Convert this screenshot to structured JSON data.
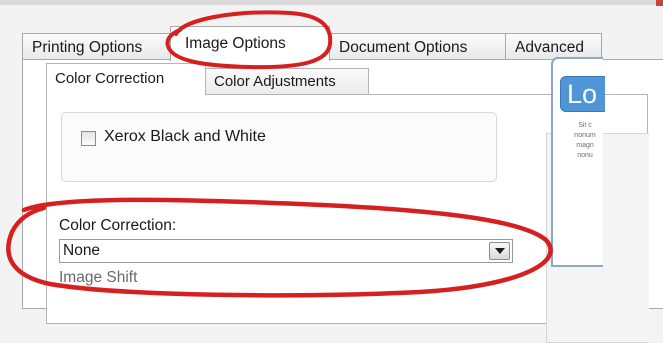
{
  "main_tabs": [
    {
      "label": "Printing Options"
    },
    {
      "label": "Image Options",
      "active": true
    },
    {
      "label": "Document Options"
    },
    {
      "label": "Advanced"
    }
  ],
  "sub_tabs": [
    {
      "label": "Color Correction",
      "active": true
    },
    {
      "label": "Color Adjustments"
    }
  ],
  "bw_option": {
    "label": "Xerox Black and White",
    "checked": false
  },
  "color_correction": {
    "label": "Color Correction:",
    "value": "None"
  },
  "next_section": {
    "label": "Image Shift"
  },
  "preview": {
    "logo_text": "Lo",
    "lines": [
      "Sit c",
      "nonum",
      "magn",
      "nonu"
    ]
  },
  "colors": {
    "annotation_red": "#d62020",
    "logo_blue": "#4f95d8"
  }
}
